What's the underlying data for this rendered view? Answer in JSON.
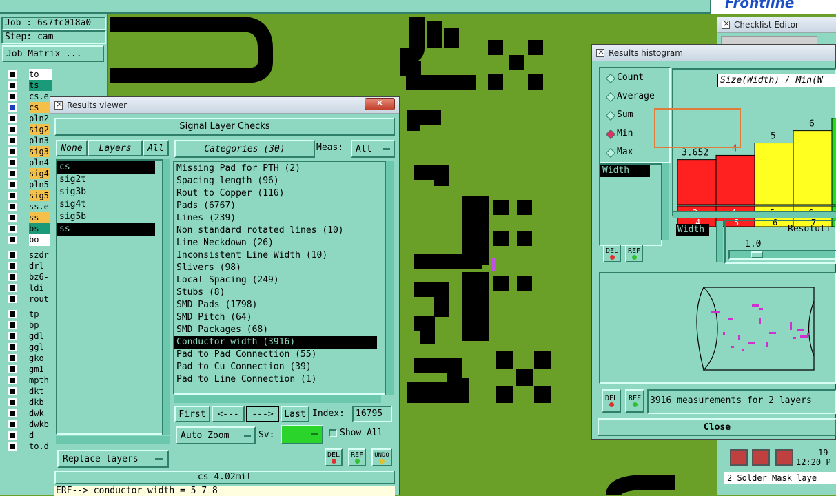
{
  "background": {
    "board_color": "#6aa028",
    "trace_color": "#000000"
  },
  "left_panel": {
    "job_label": "Job : 6s7fc018a0",
    "step_label": "Step: cam",
    "job_matrix_button": "Job Matrix ...",
    "layers": [
      {
        "name": "to",
        "color": "#ffffff"
      },
      {
        "name": "ts",
        "color": "#1a9a78"
      },
      {
        "name": "cs.e",
        "color": "#8ed8c2"
      },
      {
        "name": "cs",
        "color": "#f5c04a"
      },
      {
        "name": "pln2",
        "color": "#8ed8c2"
      },
      {
        "name": "sig2",
        "color": "#f5c04a"
      },
      {
        "name": "pln3",
        "color": "#8ed8c2"
      },
      {
        "name": "sig3",
        "color": "#f5c04a"
      },
      {
        "name": "pln4",
        "color": "#8ed8c2"
      },
      {
        "name": "sig4",
        "color": "#f5c04a"
      },
      {
        "name": "pln5",
        "color": "#8ed8c2"
      },
      {
        "name": "sig5",
        "color": "#f5c04a"
      },
      {
        "name": "ss.e",
        "color": "#8ed8c2"
      },
      {
        "name": "ss",
        "color": "#f5c04a"
      },
      {
        "name": "bs",
        "color": "#1a9a78"
      },
      {
        "name": "bo",
        "color": "#ffffff"
      },
      {
        "name": "szdr",
        "color": "#8ed8c2"
      },
      {
        "name": "drl",
        "color": "#8ed8c2"
      },
      {
        "name": "bz6-",
        "color": "#8ed8c2"
      },
      {
        "name": "ldi",
        "color": "#8ed8c2"
      },
      {
        "name": "rout",
        "color": "#8ed8c2"
      },
      {
        "name": "tp",
        "color": "#8ed8c2"
      },
      {
        "name": "bp",
        "color": "#8ed8c2"
      },
      {
        "name": "gdl",
        "color": "#8ed8c2"
      },
      {
        "name": "ggl",
        "color": "#8ed8c2"
      },
      {
        "name": "gko",
        "color": "#8ed8c2"
      },
      {
        "name": "gm1",
        "color": "#8ed8c2"
      },
      {
        "name": "mpth",
        "color": "#8ed8c2"
      },
      {
        "name": "dkt",
        "color": "#8ed8c2"
      },
      {
        "name": "dkb",
        "color": "#8ed8c2"
      },
      {
        "name": "dwk",
        "color": "#8ed8c2"
      },
      {
        "name": "dwkb",
        "color": "#8ed8c2"
      },
      {
        "name": "d",
        "color": "#8ed8c2"
      },
      {
        "name": "to.d",
        "color": "#8ed8c2"
      }
    ]
  },
  "results_viewer": {
    "title": "Results viewer",
    "close_icon": "close-icon",
    "header": "Signal Layer Checks",
    "none_button": "None",
    "layers_button": "Layers",
    "all_button": "All",
    "layer_list": [
      "cs",
      "sig2t",
      "sig3b",
      "sig4t",
      "sig5b",
      "ss"
    ],
    "selected_layers": [
      "cs",
      "ss"
    ],
    "categories_button": "Categories (30)",
    "meas_label": "Meas:",
    "meas_value": "All",
    "categories": [
      "Missing Pad for PTH (2)",
      "Spacing length (96)",
      "Rout to Copper (116)",
      "Pads (6767)",
      "Lines (239)",
      "Non standard rotated lines (10)",
      "Line Neckdown (26)",
      "Inconsistent Line Width (10)",
      "Slivers (98)",
      "Local Spacing (249)",
      "Stubs (8)",
      "SMD Pads (1798)",
      "SMD Pitch (64)",
      "SMD Packages (68)",
      "Conductor width (3916)",
      "Pad to Pad Connection (55)",
      "Pad to Cu Connection (39)",
      "Pad to Line Connection (1)"
    ],
    "selected_category": "Conductor width (3916)",
    "first_button": "First",
    "prev_button": "<---",
    "next_button": "--->",
    "last_button": "Last",
    "index_label": "Index:",
    "index_value": "16795",
    "auto_zoom_button": "Auto Zoom",
    "sv_label": "Sv:",
    "sv_color": "#2bd42b",
    "show_all_label": "Show All",
    "replace_layers_button": "Replace layers",
    "del_button": "DEL",
    "ref_button": "REF",
    "undo_button": "UNDO",
    "status_text": "cs 4.02mil",
    "erf_text": "ERF--> conductor width = 5 7 8"
  },
  "histogram": {
    "title": "Results histogram",
    "options": [
      "Count",
      "Average",
      "Sum",
      "Min",
      "Max"
    ],
    "selected_option": "Min",
    "chart_title": "Size(Width) / Min(W",
    "field_list": [
      "Width"
    ],
    "width_label": "Width",
    "resolution_label": "Resoluti",
    "resolution_value": "1.0",
    "del_button": "DEL",
    "ref_button": "REF",
    "measurements_text": "3916 measurements for 2 layers",
    "close_button": "Close",
    "highlight_color": "#e07b3a"
  },
  "chart_data": {
    "type": "bar",
    "categories": [
      "3-4",
      "4-5",
      "5-6",
      "6-7",
      "7-"
    ],
    "values": [
      3.652,
      4,
      5,
      6,
      7
    ],
    "value_labels": [
      "3.652",
      "4",
      "5",
      "6",
      "7"
    ],
    "colors": [
      "#ff2020",
      "#ff2020",
      "#ffff20",
      "#ffff20",
      "#20e020"
    ],
    "title": "Size(Width) / Min(W",
    "ylim": [
      0,
      7.6
    ]
  },
  "checklist_editor": {
    "title": "Checklist Editor"
  },
  "taskbar": {
    "time_top": "19",
    "time_bottom": "12:20 P",
    "solder_text": "2 Solder Mask laye"
  },
  "top_bar": {
    "logo_text": "Frontline"
  }
}
